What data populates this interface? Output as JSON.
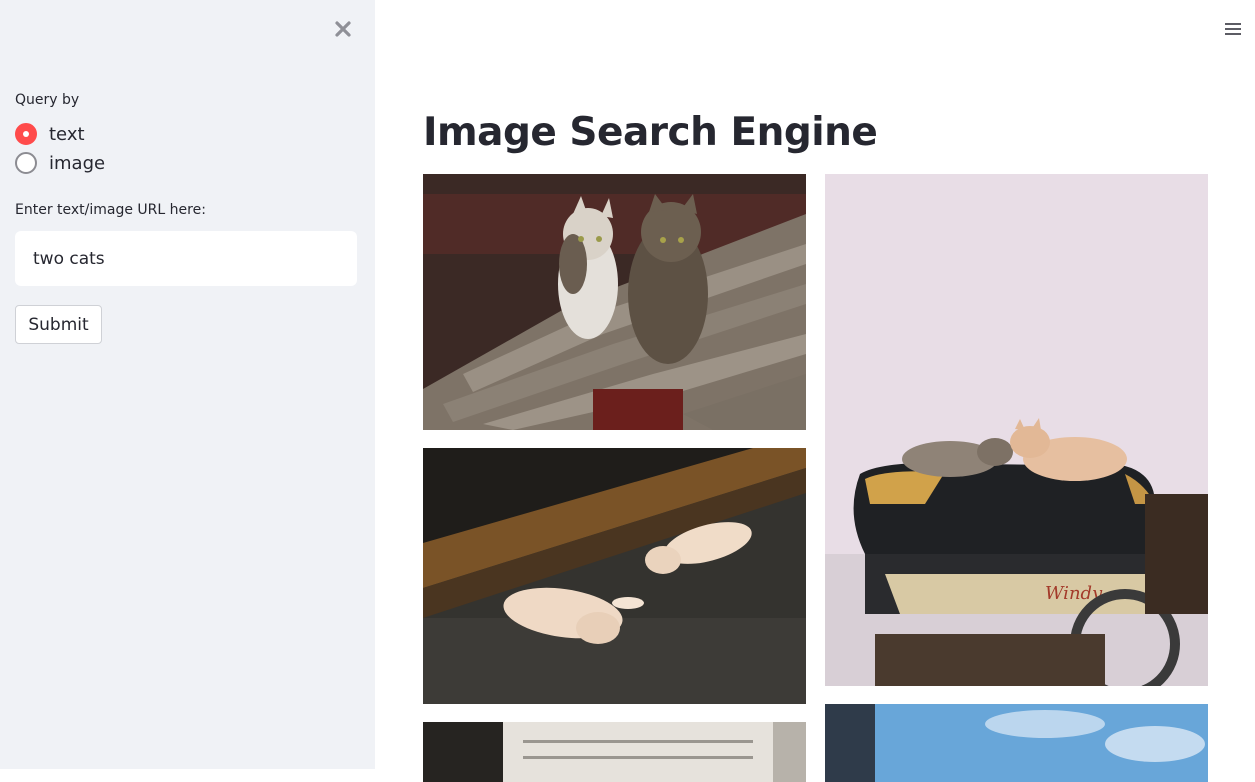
{
  "sidebar": {
    "close_icon": "close-icon",
    "query_label": "Query by",
    "radio_options": [
      {
        "label": "text",
        "checked": true
      },
      {
        "label": "image",
        "checked": false
      }
    ],
    "input_label": "Enter text/image URL here:",
    "input_value": "two cats",
    "submit_label": "Submit",
    "accent_color": "#ff4b4b",
    "background_color": "#f0f2f6"
  },
  "main": {
    "menu_icon": "hamburger-menu-icon",
    "title": "Image Search Engine",
    "results": [
      {
        "subject": "two cats standing on a wooden bench"
      },
      {
        "subject": "two cats sleeping under a ledge"
      },
      {
        "subject": "two cats lying on a motorcycle seat"
      },
      {
        "subject": "cropped photo, partially visible"
      },
      {
        "subject": "sky photo, partially visible"
      }
    ]
  }
}
